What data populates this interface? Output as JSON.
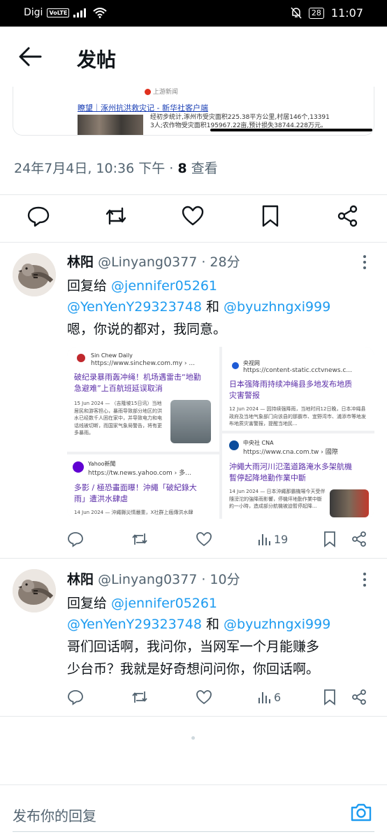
{
  "status_bar": {
    "carrier": "Digi",
    "volte": "VoLTE",
    "battery": "28",
    "time": "11:07"
  },
  "header": {
    "title": "发帖"
  },
  "embed": {
    "source": "上游新闻",
    "headline": "瞭望｜涿州抗洪救灾记 - 新华社客户端",
    "body_line1": "经初步统计,涿州市受灾面积225.38平方公里,村居146个,13391",
    "body_line2": "3人;农作物受灾面积195967.22亩,预计损失38744.228万元。"
  },
  "post": {
    "timestamp": "24年7月4日, 10:36 下午 · ",
    "views_count": "8",
    "views_label": " 查看"
  },
  "replies": [
    {
      "name": "林阳",
      "handle": "@Linyang0377 · 28分",
      "reply_to_label": "回复给 ",
      "mention1": "@jennifer05261",
      "mention2": "@YenYenY29323748",
      "and_label": " 和 ",
      "mention3": "@byuzhngxi999",
      "text": "嗯，你说的都对，我同意。",
      "views": "19"
    },
    {
      "name": "林阳",
      "handle": "@Linyang0377 · 10分",
      "reply_to_label": "回复给 ",
      "mention1": "@jennifer05261",
      "mention2": "@YenYenY29323748",
      "and_label": " 和 ",
      "mention3": "@byuzhngxi999",
      "text_line1": "哥们回话啊，我问你，当网军一个月能赚多",
      "text_line2": "少台币？我就是好奇想问问你，你回话啊。",
      "views": "6"
    }
  ],
  "news_cards": [
    {
      "source": "Sin Chew Daily",
      "url": "https://www.sinchew.com.my › ...",
      "title_line1": "破纪录暴雨轰冲绳！机场遇雷击“地勤",
      "title_line2": "急避难”上百航班延误取消",
      "body": "15 Jun 2024 — （吉隆坡15日讯）当地居民和游客担心，暴雨导致部分地区的洪水已经数千人困在家中，并导致电力和电话线被切断，而国家气象局警告，将有更多暴雨。"
    },
    {
      "source": "央视网",
      "url": "https://content-static.cctvnews.c...",
      "title_line1": "日本强降雨持续冲绳县多地发布地质",
      "title_line2": "灾害警报",
      "body": "12 Jun 2024 — 因持续强降雨，当地时间12日晚，日本冲绳县政府及当地气象部门向该县的那霸市、宜野湾市、浦添市等地发布地质灾害警报，提醒当地民..."
    },
    {
      "source": "Yahoo新聞",
      "url": "https://tw.news.yahoo.com › 多...",
      "title_line1": "多影 / 極恐畫面曝！沖繩「破紀錄大",
      "title_line2": "雨」遭洪水肆虐",
      "body": "14 Jun 2024 — 沖繩縣災情嚴重，X社群上瘋傳洪水肆"
    },
    {
      "source": "中央社 CNA",
      "url": "https://www.cna.com.tw › 國際",
      "title_line1": "沖繩大雨河川氾濫道路淹水多架航機",
      "title_line2": "暫停起降地勤作業中斷",
      "body": "14 Jun 2024 — 日本沖繩那霸機場今天受伴隨滂沱的強降雨影響，停機坪地勤作業中斷約一小時，造成部分航機被迫暫停起降..."
    }
  ],
  "reply_bar": {
    "placeholder": "发布你的回复"
  },
  "icons": [
    "back-arrow-icon",
    "reply-icon",
    "retweet-icon",
    "like-icon",
    "bookmark-icon",
    "share-icon",
    "views-icon",
    "more-icon",
    "camera-icon"
  ],
  "colors": {
    "link": "#1d9bf0",
    "secondary_text": "#536471",
    "news_title": "#5b2fa8"
  }
}
